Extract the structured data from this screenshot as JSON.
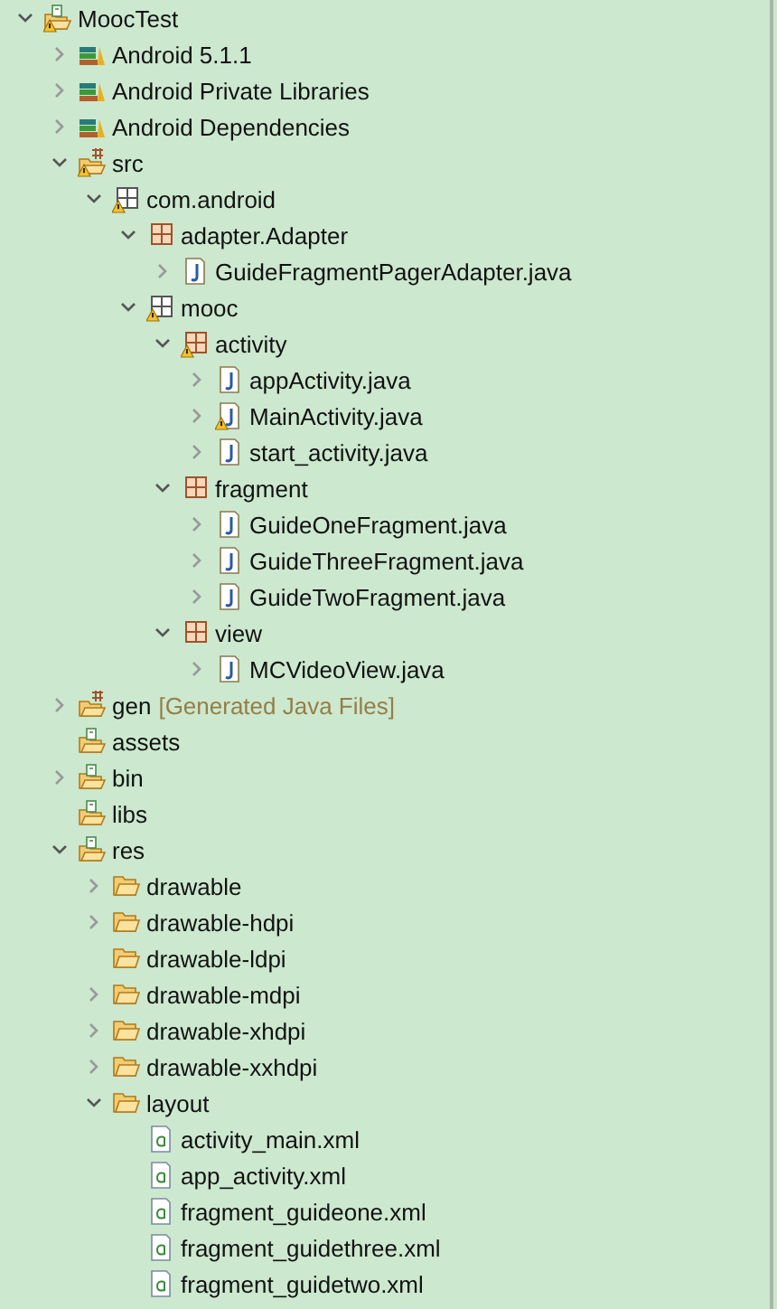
{
  "tree": [
    {
      "label": "MoocTest",
      "kind": "project",
      "expanded": true,
      "warning": true,
      "children": [
        {
          "label": "Android 5.1.1",
          "kind": "library",
          "expanded": false,
          "warning": false
        },
        {
          "label": "Android Private Libraries",
          "kind": "library",
          "expanded": false,
          "warning": false
        },
        {
          "label": "Android Dependencies",
          "kind": "library",
          "expanded": false,
          "warning": false
        },
        {
          "label": "src",
          "kind": "source",
          "expanded": true,
          "warning": true,
          "children": [
            {
              "label": "com.android",
              "kind": "package-empty",
              "expanded": true,
              "warning": true,
              "children": [
                {
                  "label": "adapter.Adapter",
                  "kind": "package",
                  "expanded": true,
                  "warning": false,
                  "children": [
                    {
                      "label": "GuideFragmentPagerAdapter.java",
                      "kind": "java",
                      "expanded": false,
                      "warning": false
                    }
                  ]
                },
                {
                  "label": "mooc",
                  "kind": "package-empty",
                  "expanded": true,
                  "warning": true,
                  "children": [
                    {
                      "label": "activity",
                      "kind": "package",
                      "expanded": true,
                      "warning": true,
                      "children": [
                        {
                          "label": "appActivity.java",
                          "kind": "java",
                          "expanded": false,
                          "warning": false
                        },
                        {
                          "label": "MainActivity.java",
                          "kind": "java",
                          "expanded": false,
                          "warning": true
                        },
                        {
                          "label": "start_activity.java",
                          "kind": "java",
                          "expanded": false,
                          "warning": false
                        }
                      ]
                    },
                    {
                      "label": "fragment",
                      "kind": "package",
                      "expanded": true,
                      "warning": false,
                      "children": [
                        {
                          "label": "GuideOneFragment.java",
                          "kind": "java",
                          "expanded": false,
                          "warning": false
                        },
                        {
                          "label": "GuideThreeFragment.java",
                          "kind": "java",
                          "expanded": false,
                          "warning": false
                        },
                        {
                          "label": "GuideTwoFragment.java",
                          "kind": "java",
                          "expanded": false,
                          "warning": false
                        }
                      ]
                    },
                    {
                      "label": "view",
                      "kind": "package",
                      "expanded": true,
                      "warning": false,
                      "children": [
                        {
                          "label": "MCVideoView.java",
                          "kind": "java",
                          "expanded": false,
                          "warning": false
                        }
                      ]
                    }
                  ]
                }
              ]
            }
          ]
        },
        {
          "label": "gen",
          "decoration": "[Generated Java Files]",
          "kind": "gen",
          "expanded": false,
          "warning": false
        },
        {
          "label": "assets",
          "kind": "project-folder",
          "warning": false
        },
        {
          "label": "bin",
          "kind": "project-folder",
          "expanded": false,
          "warning": false
        },
        {
          "label": "libs",
          "kind": "project-folder",
          "warning": false
        },
        {
          "label": "res",
          "kind": "project-folder",
          "expanded": true,
          "warning": false,
          "children": [
            {
              "label": "drawable",
              "kind": "folder",
              "expanded": false,
              "warning": false
            },
            {
              "label": "drawable-hdpi",
              "kind": "folder",
              "expanded": false,
              "warning": false
            },
            {
              "label": "drawable-ldpi",
              "kind": "folder",
              "warning": false
            },
            {
              "label": "drawable-mdpi",
              "kind": "folder",
              "expanded": false,
              "warning": false
            },
            {
              "label": "drawable-xhdpi",
              "kind": "folder",
              "expanded": false,
              "warning": false
            },
            {
              "label": "drawable-xxhdpi",
              "kind": "folder",
              "expanded": false,
              "warning": false
            },
            {
              "label": "layout",
              "kind": "folder",
              "expanded": true,
              "warning": false,
              "children": [
                {
                  "label": "activity_main.xml",
                  "kind": "xml",
                  "warning": false
                },
                {
                  "label": "app_activity.xml",
                  "kind": "xml",
                  "warning": false
                },
                {
                  "label": "fragment_guideone.xml",
                  "kind": "xml",
                  "warning": false
                },
                {
                  "label": "fragment_guidethree.xml",
                  "kind": "xml",
                  "warning": false
                },
                {
                  "label": "fragment_guidetwo.xml",
                  "kind": "xml",
                  "warning": false
                }
              ]
            }
          ]
        }
      ]
    }
  ]
}
